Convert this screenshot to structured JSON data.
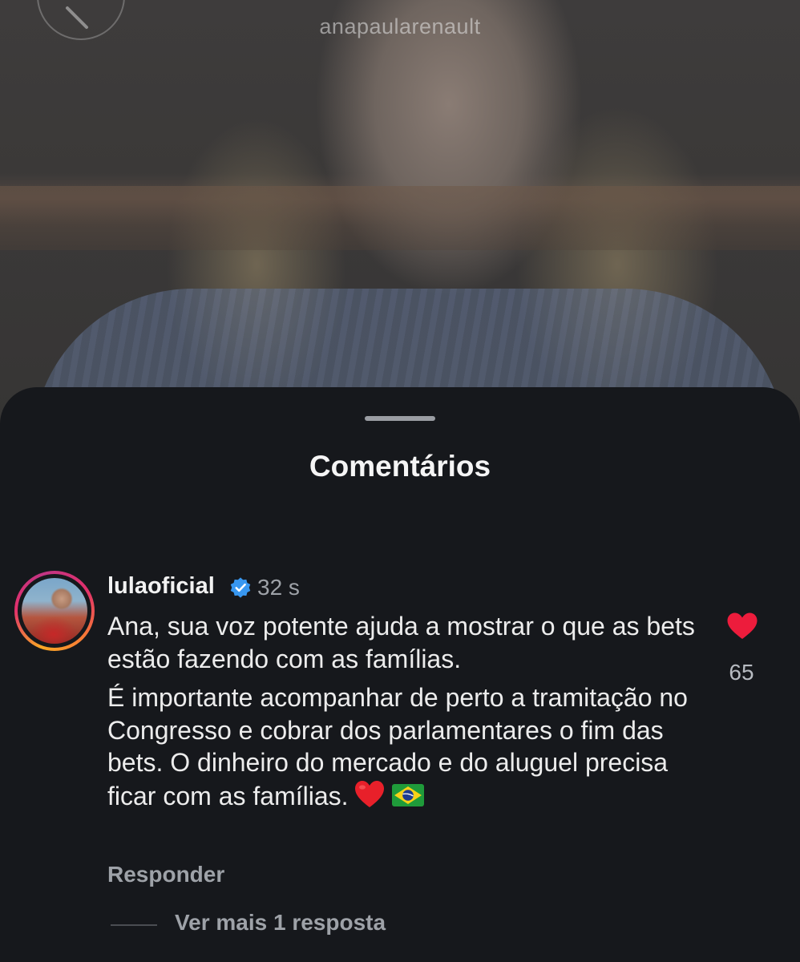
{
  "video": {
    "username": "anapaularenault"
  },
  "sheet": {
    "title": "Comentários"
  },
  "comment": {
    "username": "lulaoficial",
    "timestamp": "32 s",
    "paragraph1": "Ana, sua voz potente ajuda a mostrar o que as bets estão fazendo com as famílias.",
    "paragraph2": "É importante acompanhar de perto a tramitação no Congresso e cobrar dos parlamentares o fim das bets. O dinheiro do mercado e do aluguel precisa ficar com as famílias.",
    "emojis": [
      "red-heart-emoji",
      "brazil-flag-emoji"
    ],
    "like_count": "65",
    "liked": true,
    "reply_label": "Responder",
    "view_more_label": "Ver mais 1 resposta"
  },
  "colors": {
    "sheet_bg": "#16181c",
    "like_red": "#ed1c3c",
    "verified_blue": "#3897f0",
    "muted_text": "#9ea2a8"
  }
}
